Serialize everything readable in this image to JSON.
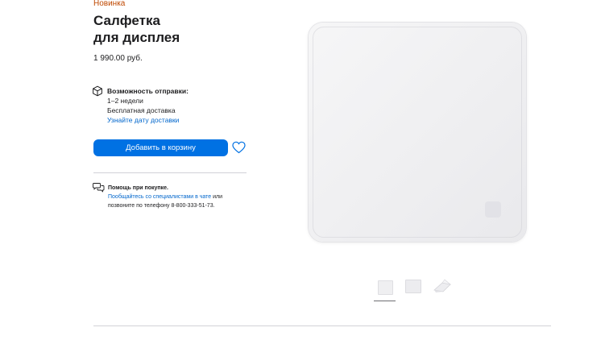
{
  "product": {
    "badge": "Новинка",
    "title_line1": "Салфетка",
    "title_line2": "для дисплея",
    "price": "1 990.00 руб."
  },
  "shipping": {
    "heading": "Возможность отправки:",
    "eta": "1–2 недели",
    "free": "Бесплатная доставка",
    "link": "Узнайте дату доставки"
  },
  "actions": {
    "add_to_bag": "Добавить в корзину"
  },
  "help": {
    "heading": "Помощь при покупке.",
    "link": "Пообщайтесь со специалистами в чате",
    "or": " или",
    "phone_text": "позвоните по телефону 8-800-333-51-73."
  },
  "gallery": {
    "selected_index": 0,
    "thumbnail_count": 3
  },
  "colors": {
    "accent": "#0071e3",
    "link": "#0066cc",
    "badge": "#bf4800"
  }
}
